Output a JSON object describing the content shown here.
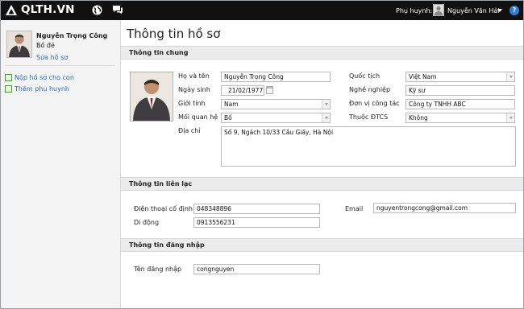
{
  "topbar": {
    "logo": "QLTH.VN",
    "parent_label": "Phụ huynh:",
    "user_name": "Nguyễn Văn Hải",
    "help": "?"
  },
  "sidebar": {
    "profile": {
      "name": "Nguyễn Trọng Công",
      "role": "Bố đẻ",
      "edit": "Sửa hồ sơ"
    },
    "links": [
      {
        "label": "Nộp hồ sơ cho con"
      },
      {
        "label": "Thêm phụ huynh"
      }
    ]
  },
  "page_title": "Thông tin hồ sơ",
  "general": {
    "title": "Thông tin chung",
    "fullname": {
      "label": "Họ và tên",
      "value": "Nguyễn Trọng Công"
    },
    "birthday": {
      "label": "Ngày sinh",
      "value": "21/02/1977"
    },
    "gender": {
      "label": "Giới tính",
      "value": "Nam"
    },
    "relation": {
      "label": "Mối quan hệ",
      "value": "Bố"
    },
    "address": {
      "label": "Địa chỉ",
      "value": "Số 9, Ngách 10/33 Cầu Giấy, Hà Nội"
    },
    "nationality": {
      "label": "Quốc tịch",
      "value": "Việt Nam"
    },
    "job": {
      "label": "Nghề nghiệp",
      "value": "Kỹ sư"
    },
    "workplace": {
      "label": "Đơn vị công tác",
      "value": "Công ty TNHH ABC"
    },
    "priority": {
      "label": "Thuộc ĐTCS",
      "value": "Không"
    }
  },
  "contact": {
    "title": "Thông tin liên lạc",
    "landline": {
      "label": "Điện thoại cố định",
      "value": "048348896"
    },
    "mobile": {
      "label": "Di động",
      "value": "0913556231"
    },
    "email": {
      "label": "Email",
      "value": "nguyentrongcong@gmail.com"
    }
  },
  "login": {
    "title": "Thông tin đăng nhập",
    "username": {
      "label": "Tên đăng nhập",
      "value": "congnguyen"
    }
  }
}
